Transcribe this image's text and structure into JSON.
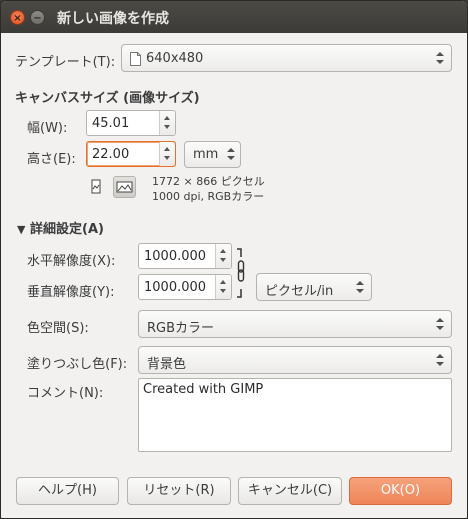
{
  "window": {
    "title": "新しい画像を作成",
    "close_glyph": "×",
    "min_glyph": "−"
  },
  "template": {
    "label": "テンプレート(T):",
    "value": "640x480"
  },
  "canvas_size": {
    "heading": "キャンバスサイズ (画像サイズ)",
    "width_label": "幅(W):",
    "width_value": "45.01",
    "height_label": "高さ(E):",
    "height_value": "22.00",
    "unit_value": "mm",
    "info_line1": "1772 × 866 ピクセル",
    "info_line2": "1000 dpi, RGBカラー"
  },
  "advanced": {
    "heading": "詳細設定(A)",
    "expander_glyph": "▼",
    "xres_label": "水平解像度(X):",
    "xres_value": "1000.000",
    "yres_label": "垂直解像度(Y):",
    "yres_value": "1000.000",
    "res_unit_value": "ピクセル/in",
    "colorspace_label": "色空間(S):",
    "colorspace_value": "RGBカラー",
    "fill_label": "塗りつぶし色(F):",
    "fill_value": "背景色",
    "comment_label": "コメント(N):",
    "comment_value": "Created with GIMP"
  },
  "buttons": {
    "help": "ヘルプ(H)",
    "reset": "リセット(R)",
    "cancel": "キャンセル(C)",
    "ok": "OK(O)"
  },
  "colors": {
    "accent": "#f0855a",
    "titlebar": "#3c3b37",
    "focus": "#e7702a"
  }
}
